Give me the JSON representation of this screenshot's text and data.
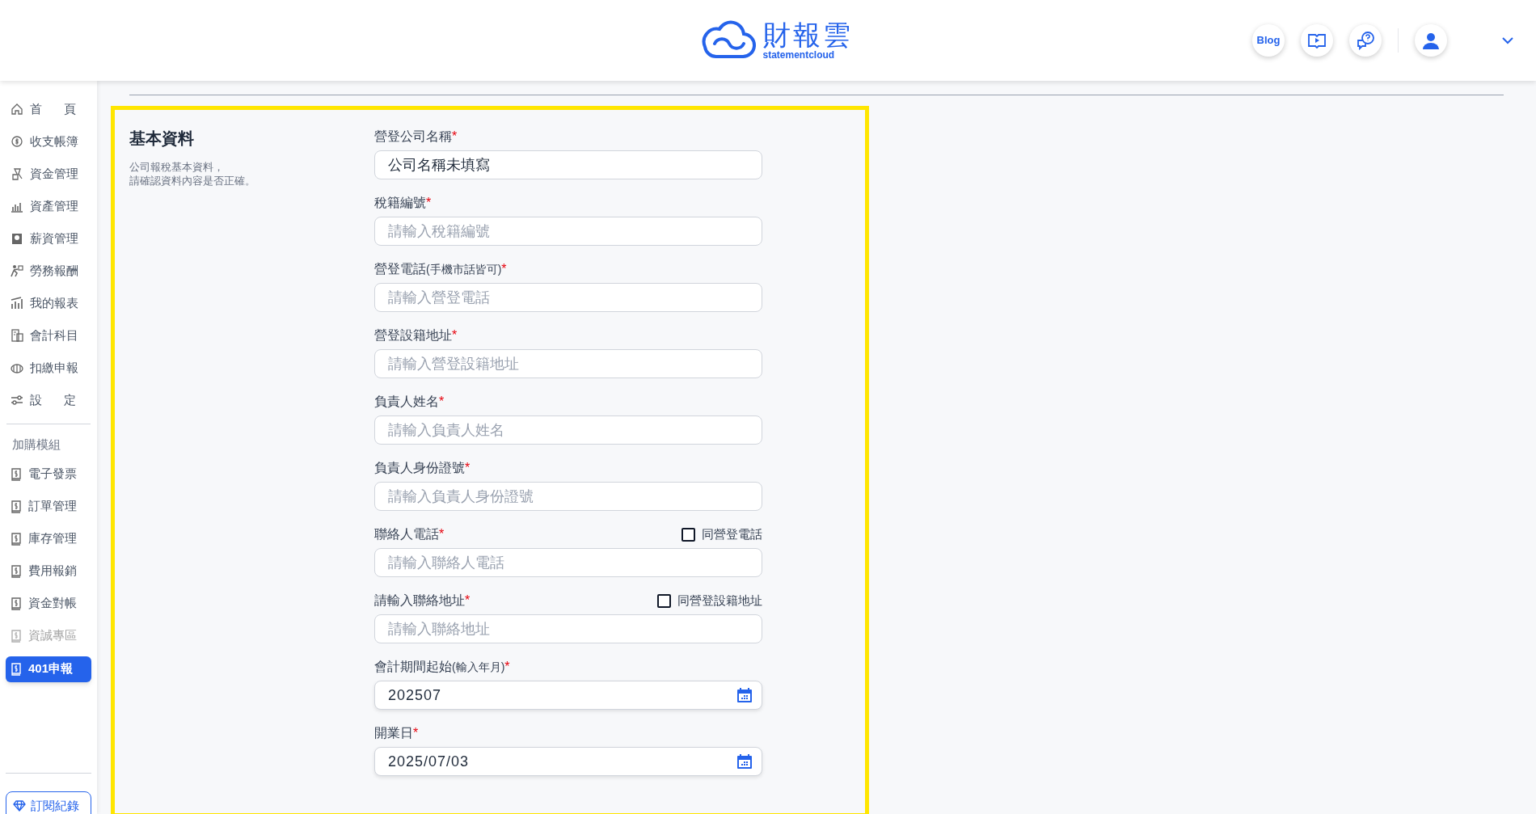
{
  "header": {
    "logo": {
      "title": "財報雲",
      "subtitle": "statementcloud"
    },
    "blog_button": "Blog"
  },
  "sidebar": {
    "items": [
      {
        "label": "首頁",
        "selected": false
      },
      {
        "label": "收支帳簿",
        "selected": false
      },
      {
        "label": "資金管理",
        "selected": false
      },
      {
        "label": "資產管理",
        "selected": false
      },
      {
        "label": "薪資管理",
        "selected": false
      },
      {
        "label": "勞務報酬",
        "selected": false
      },
      {
        "label": "我的報表",
        "selected": false
      },
      {
        "label": "會計科目",
        "selected": false
      },
      {
        "label": "扣繳申報",
        "selected": false
      },
      {
        "label": "設定",
        "selected": false
      }
    ],
    "modules_heading": "加購模組",
    "modules": [
      {
        "label": "電子發票",
        "selected": false,
        "disabled": false
      },
      {
        "label": "訂單管理",
        "selected": false,
        "disabled": false
      },
      {
        "label": "庫存管理",
        "selected": false,
        "disabled": false
      },
      {
        "label": "費用報銷",
        "selected": false,
        "disabled": false
      },
      {
        "label": "資金對帳",
        "selected": false,
        "disabled": false
      },
      {
        "label": "資誠專區",
        "selected": false,
        "disabled": true
      },
      {
        "label": "401申報",
        "selected": true,
        "disabled": false
      }
    ],
    "subscription_button": "訂閱紀錄"
  },
  "form": {
    "title": "基本資料",
    "description": [
      "公司報稅基本資料，",
      "請確認資料內容是否正確。"
    ],
    "fields": [
      {
        "kind": "text",
        "label": "營登公司名稱",
        "required_mark": "*",
        "value": "公司名稱未填寫"
      },
      {
        "kind": "text",
        "label": "稅籍編號",
        "required_mark": "*",
        "placeholder": "請輸入稅籍編號"
      },
      {
        "kind": "text",
        "label": "營登電話",
        "label_note": "(手機市話皆可)",
        "required_mark": "*",
        "placeholder": "請輸入營登電話"
      },
      {
        "kind": "text",
        "label": "營登設籍地址",
        "required_mark": "*",
        "placeholder": "請輸入營登設籍地址"
      },
      {
        "kind": "text",
        "label": "負責人姓名",
        "required_mark": "*",
        "placeholder": "請輸入負責人姓名"
      },
      {
        "kind": "text",
        "label": "負責人身份證號",
        "required_mark": "*",
        "placeholder": "請輸入負責人身份證號"
      },
      {
        "kind": "text",
        "label": "聯絡人電話",
        "required_mark": "*",
        "placeholder": "請輸入聯絡人電話",
        "checkbox": {
          "label": "同營登電話",
          "checked": false
        }
      },
      {
        "kind": "text",
        "label": "請輸入聯絡地址",
        "required_mark": "*",
        "placeholder": "請輸入聯絡地址",
        "checkbox": {
          "label": "同營登設籍地址",
          "checked": false
        }
      },
      {
        "kind": "date",
        "label": "會計期間起始",
        "label_note": "(輸入年月)",
        "required_mark": "*",
        "value": "202507"
      },
      {
        "kind": "date",
        "label": "開業日",
        "required_mark": "*",
        "value": "2025/07/03"
      }
    ]
  }
}
